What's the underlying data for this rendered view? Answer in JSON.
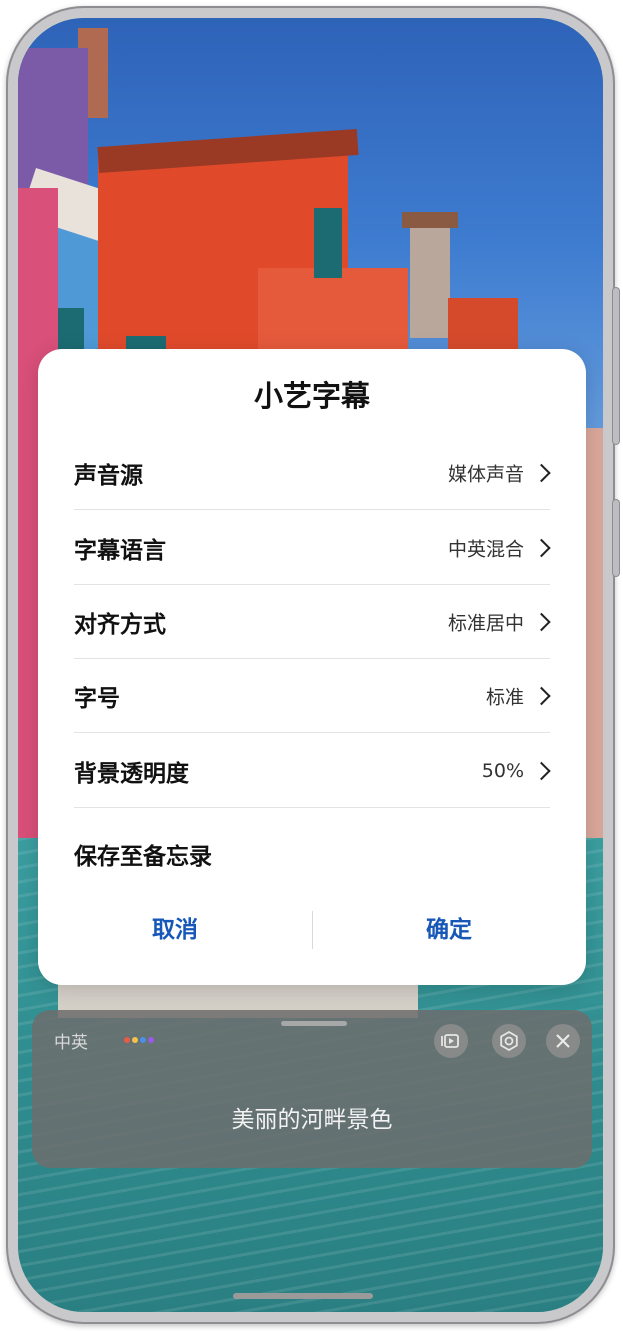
{
  "dialog": {
    "title": "小艺字幕",
    "rows": [
      {
        "label": "声音源",
        "value": "媒体声音"
      },
      {
        "label": "字幕语言",
        "value": "中英混合"
      },
      {
        "label": "对齐方式",
        "value": "标准居中"
      },
      {
        "label": "字号",
        "value": "标准"
      },
      {
        "label": "背景透明度",
        "value": "50%"
      }
    ],
    "save_label": "保存至备忘录",
    "cancel_label": "取消",
    "confirm_label": "确定"
  },
  "caption_panel": {
    "language": "中英",
    "subtitle_text": "美丽的河畔景色",
    "icons": [
      "display-switch-icon",
      "settings-gear-icon",
      "close-icon"
    ]
  },
  "colors": {
    "accent": "#1657b8",
    "dialog_bg": "#ffffff",
    "panel_bg": "#6e6e6e"
  }
}
